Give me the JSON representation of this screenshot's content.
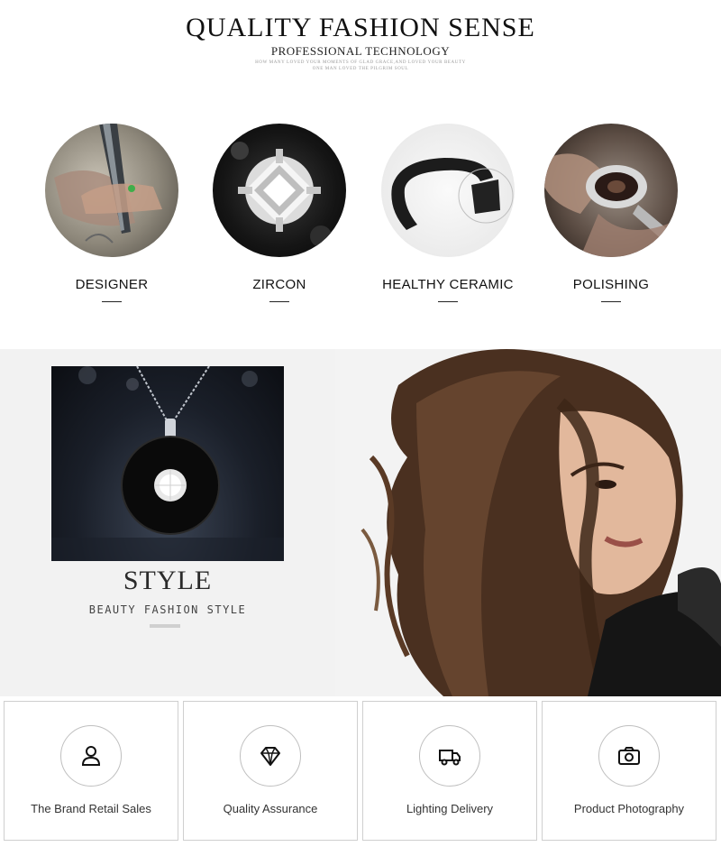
{
  "header": {
    "title": "QUALITY FASHION SENSE",
    "subtitle": "PROFESSIONAL TECHNOLOGY",
    "small_line1": "HOW MANY LOVED YOUR MOMENTS OF GLAD GRACE,AND LOVED YOUR BEAUTY",
    "small_line2": "ONE MAN LOVED THE PILGRIM SOUL"
  },
  "features": [
    {
      "label": "DESIGNER",
      "image": "designer-hands-image"
    },
    {
      "label": "ZIRCON",
      "image": "zircon-stone-image"
    },
    {
      "label": "HEALTHY CERAMIC",
      "image": "ceramic-ring-image"
    },
    {
      "label": "POLISHING",
      "image": "polishing-ring-image"
    }
  ],
  "banner": {
    "title": "STYLE",
    "subtitle": "BEAUTY FASHION STYLE"
  },
  "services": [
    {
      "label": "The Brand Retail Sales",
      "icon": "user-icon"
    },
    {
      "label": "Quality Assurance",
      "icon": "diamond-icon"
    },
    {
      "label": "Lighting Delivery",
      "icon": "truck-icon"
    },
    {
      "label": "Product Photography",
      "icon": "camera-icon"
    }
  ],
  "colors": {
    "text": "#111111",
    "banner_bg": "#efefef",
    "border": "#cfcfcf"
  }
}
